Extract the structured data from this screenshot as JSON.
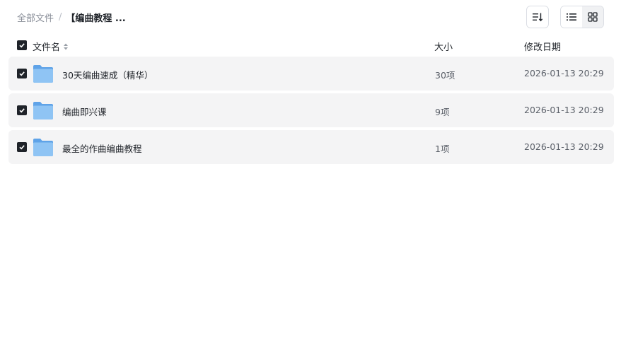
{
  "breadcrumb": {
    "root": "全部文件",
    "separator": "/",
    "current": "【编曲教程 ..."
  },
  "toolbar": {
    "sort_icon": "sort-list-icon",
    "list_view_icon": "list-view-icon",
    "grid_view_icon": "grid-view-icon"
  },
  "table": {
    "columns": {
      "name": "文件名",
      "size": "大小",
      "modified": "修改日期"
    },
    "rows": [
      {
        "name": "30天编曲速成（精华）",
        "size": "30项",
        "modified": "2026-01-13 20:29"
      },
      {
        "name": "编曲即兴课",
        "size": "9项",
        "modified": "2026-01-13 20:29"
      },
      {
        "name": "最全的作曲编曲教程",
        "size": "1项",
        "modified": "2026-01-13 20:29"
      }
    ]
  },
  "colors": {
    "checkbox": "#1f2329",
    "row_bg": "#f4f4f5",
    "folder": "#7db8f0"
  }
}
